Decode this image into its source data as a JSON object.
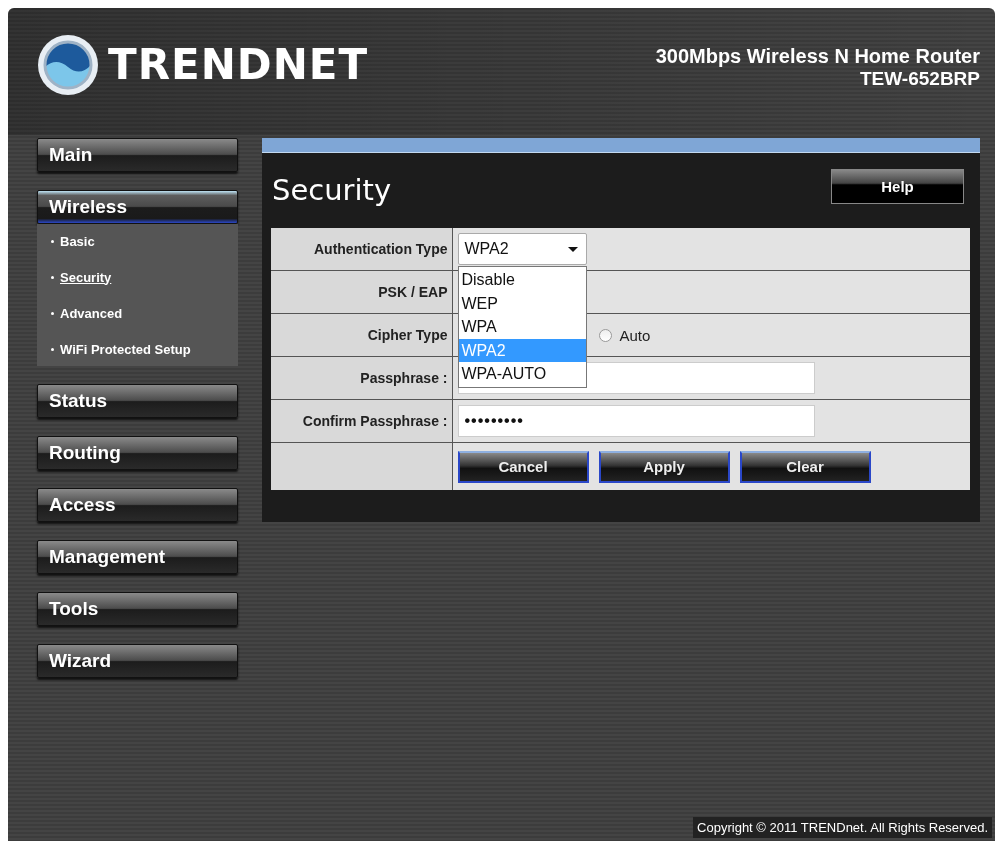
{
  "header": {
    "brand": "TRENDNET",
    "product": "300Mbps Wireless N Home Router",
    "model": "TEW-652BRP"
  },
  "sidebar": {
    "items": [
      {
        "label": "Main",
        "selected": false
      },
      {
        "label": "Wireless",
        "selected": true,
        "expanded": true,
        "children": [
          {
            "label": "Basic",
            "selected": false
          },
          {
            "label": "Security",
            "selected": true
          },
          {
            "label": "Advanced",
            "selected": false
          },
          {
            "label": "WiFi Protected Setup",
            "selected": false
          }
        ]
      },
      {
        "label": "Status",
        "selected": false
      },
      {
        "label": "Routing",
        "selected": false
      },
      {
        "label": "Access",
        "selected": false
      },
      {
        "label": "Management",
        "selected": false
      },
      {
        "label": "Tools",
        "selected": false
      },
      {
        "label": "Wizard",
        "selected": false
      }
    ]
  },
  "panel": {
    "title": "Security",
    "help_button": "Help",
    "fields": [
      {
        "kind": "select",
        "label": "Authentication Type",
        "value": "WPA2",
        "dropdown": {
          "expanded": true,
          "options": [
            {
              "label": "Disable",
              "selected": false
            },
            {
              "label": "WEP",
              "selected": false
            },
            {
              "label": "WPA",
              "selected": false
            },
            {
              "label": "WPA2",
              "selected": true
            },
            {
              "label": "WPA-AUTO",
              "selected": false
            }
          ]
        }
      },
      {
        "kind": "covered",
        "label": "PSK / EAP"
      },
      {
        "kind": "radio",
        "label": "Cipher Type",
        "options": [
          {
            "label": "Auto",
            "selected": false
          }
        ]
      },
      {
        "kind": "input",
        "label": "Passphrase :"
      },
      {
        "kind": "input",
        "label": "Confirm Passphrase :",
        "value": "•••••••••"
      },
      {
        "kind": "buttons",
        "buttons": [
          "Cancel",
          "Apply",
          "Clear"
        ]
      }
    ]
  },
  "footer": {
    "copyright": "Copyright © 2011 TRENDnet. All Rights Reserved."
  }
}
